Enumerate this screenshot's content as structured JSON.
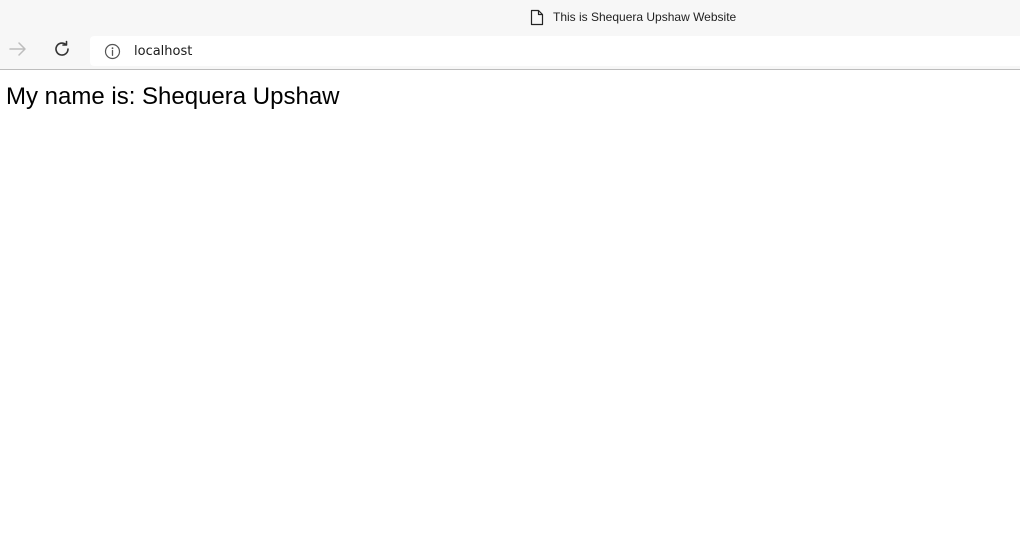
{
  "browser": {
    "tab_title": "This is Shequera Upshaw Website",
    "tab_icon": "document-icon",
    "address": "localhost",
    "address_icon": "info-icon"
  },
  "toolbar": {
    "forward_icon": "forward-arrow-icon",
    "reload_icon": "reload-icon"
  },
  "page": {
    "text": "My name is: Shequera Upshaw"
  }
}
